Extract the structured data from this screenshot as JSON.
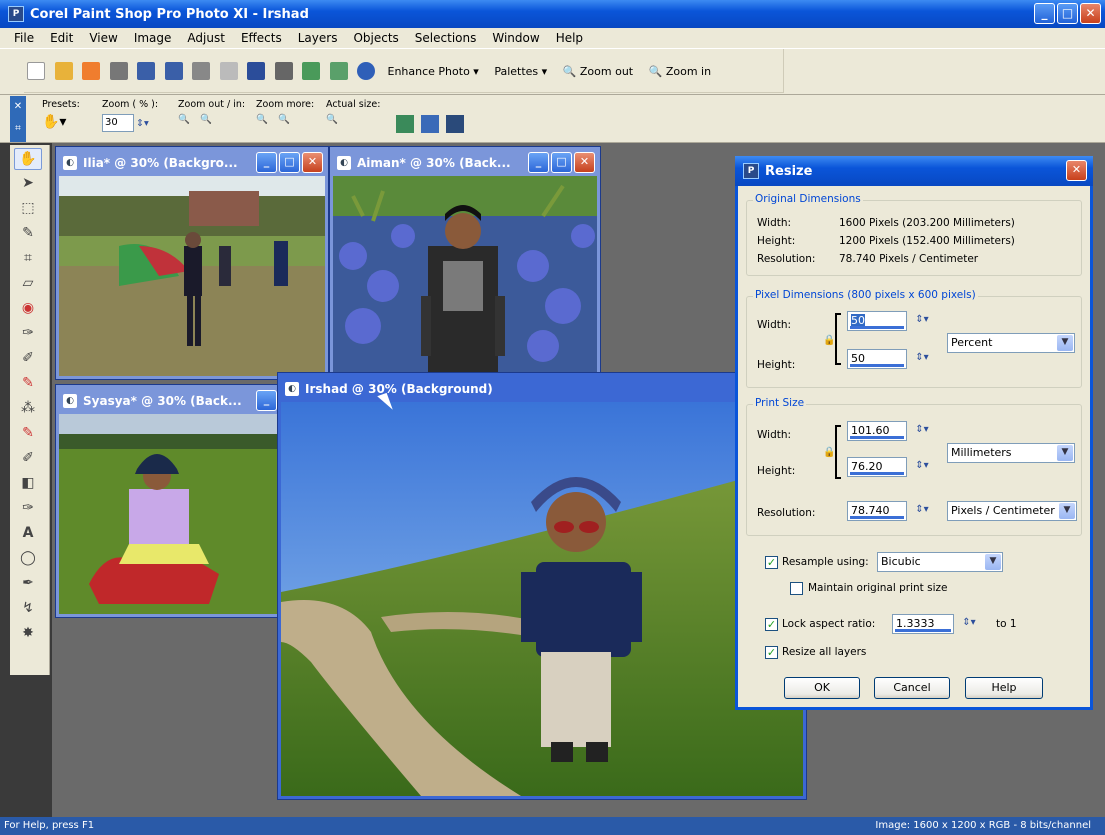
{
  "app": {
    "title": "Corel Paint Shop Pro Photo XI - Irshad",
    "icon": "psp-app-icon"
  },
  "menu": [
    "File",
    "Edit",
    "View",
    "Image",
    "Adjust",
    "Effects",
    "Layers",
    "Objects",
    "Selections",
    "Window",
    "Help"
  ],
  "toolbar": {
    "enhance_label": "Enhance Photo",
    "palettes_label": "Palettes",
    "zoom_out_label": "Zoom out",
    "zoom_in_label": "Zoom in"
  },
  "options": {
    "presets_label": "Presets:",
    "zoom_label": "Zoom ( % ):",
    "zoom_value": "30",
    "zoom_outin_label": "Zoom out / in:",
    "zoom_more_label": "Zoom more:",
    "actual_label": "Actual size:"
  },
  "windows": {
    "ilia": "Ilia* @  30% (Backgro...",
    "aiman": "Aiman* @  30% (Back...",
    "syasya": "Syasya* @  30% (Back...",
    "irshad": "Irshad @  30% (Background)"
  },
  "dialog": {
    "title": "Resize",
    "original": {
      "title": "Original Dimensions",
      "width_label": "Width:",
      "width_value": "1600 Pixels (203.200 Millimeters)",
      "height_label": "Height:",
      "height_value": "1200 Pixels (152.400 Millimeters)",
      "res_label": "Resolution:",
      "res_value": "78.740 Pixels / Centimeter"
    },
    "pixel": {
      "title": "Pixel Dimensions (800 pixels x 600 pixels)",
      "width_label": "Width:",
      "width_value": "50",
      "height_label": "Height:",
      "height_value": "50",
      "unit": "Percent"
    },
    "print": {
      "title": "Print Size",
      "width_label": "Width:",
      "width_value": "101.60",
      "height_label": "Height:",
      "height_value": "76.20",
      "unit": "Millimeters",
      "res_label": "Resolution:",
      "res_value": "78.740",
      "res_unit": "Pixels / Centimeter"
    },
    "resample_label": "Resample using:",
    "resample_value": "Bicubic",
    "maintain_label": "Maintain original print size",
    "lock_label": "Lock aspect ratio:",
    "ratio_value": "1.3333",
    "to1": "to 1",
    "resize_all_label": "Resize all layers",
    "ok": "OK",
    "cancel": "Cancel",
    "help": "Help"
  },
  "status": {
    "left": "For Help, press F1",
    "right": "Image:  1600 x 1200 x RGB - 8 bits/channel"
  }
}
